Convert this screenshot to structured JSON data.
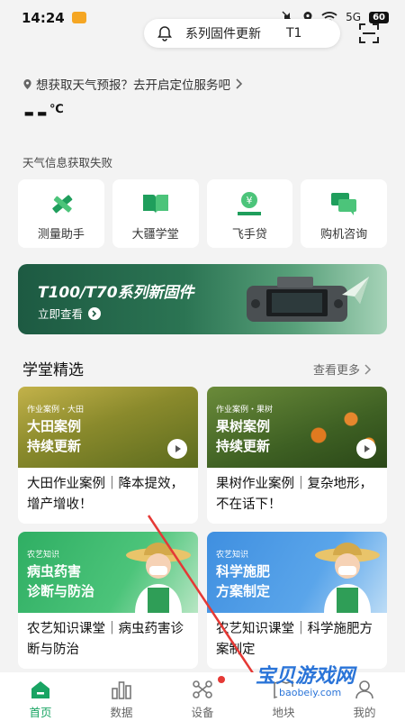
{
  "status_bar": {
    "time": "14:24",
    "battery": "60",
    "signal": "5G"
  },
  "firmware_pill": {
    "text": "系列固件更新",
    "text_overflow": "T1"
  },
  "weather": {
    "location_prompt": "想获取天气预报？去开启定位服务吧",
    "temperature": "--",
    "unit": "℃",
    "status": "天气信息获取失败"
  },
  "shortcuts": [
    {
      "label": "测量助手",
      "icon": "ruler-pencil-icon"
    },
    {
      "label": "大疆学堂",
      "icon": "book-icon"
    },
    {
      "label": "飞手贷",
      "icon": "loan-coin-icon"
    },
    {
      "label": "购机咨询",
      "icon": "chat-bubbles-icon"
    }
  ],
  "banner": {
    "title": "T100/T70系列新固件",
    "subtitle": "立即查看"
  },
  "section": {
    "title": "学堂精选",
    "more": "查看更多"
  },
  "cards": [
    {
      "tag": "作业案例・大田",
      "line1": "大田案例",
      "line2": "持续更新",
      "desc": "大田作业案例｜降本提效，增产增收！"
    },
    {
      "tag": "作业案例・果树",
      "line1": "果树案例",
      "line2": "持续更新",
      "desc": "果树作业案例｜复杂地形，不在话下！"
    },
    {
      "tag": "农艺知识",
      "line1": "病虫药害",
      "line2": "诊断与防治",
      "desc": "农艺知识课堂｜病虫药害诊断与防治"
    },
    {
      "tag": "农艺知识",
      "line1": "科学施肥",
      "line2": "方案制定",
      "desc": "农艺知识课堂｜科学施肥方案制定"
    }
  ],
  "nav": [
    {
      "label": "首页",
      "active": true
    },
    {
      "label": "数据",
      "active": false
    },
    {
      "label": "设备",
      "active": false
    },
    {
      "label": "地块",
      "active": false
    },
    {
      "label": "我的",
      "active": false
    }
  ],
  "watermark": {
    "title": "宝贝游戏网",
    "url": "baobeiy.com"
  },
  "colors": {
    "brand_green": "#19a463",
    "banner_dark": "#1d5a42",
    "badge_red": "#e53935"
  }
}
